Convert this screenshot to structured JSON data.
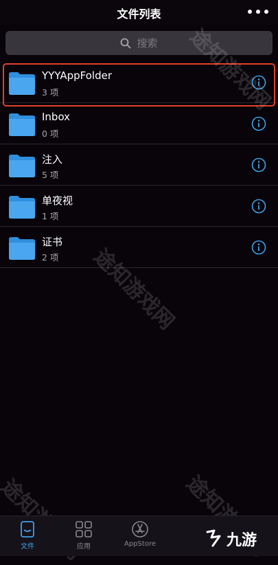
{
  "nav": {
    "title": "文件列表"
  },
  "search": {
    "placeholder": "搜索"
  },
  "folders": [
    {
      "name": "YYYAppFolder",
      "count": "3 项"
    },
    {
      "name": "Inbox",
      "count": "0 项"
    },
    {
      "name": "注入",
      "count": "5 项"
    },
    {
      "name": "单夜视",
      "count": "1 项"
    },
    {
      "name": "证书",
      "count": "2 项"
    }
  ],
  "tabs": [
    {
      "label": "文件",
      "icon": "files-tab-icon",
      "active": true
    },
    {
      "label": "应用",
      "icon": "apps-grid-icon",
      "active": false
    },
    {
      "label": "AppStore",
      "icon": "appstore-icon",
      "active": false
    }
  ],
  "watermark": "途知游戏网",
  "brand": "九游",
  "colors": {
    "accent": "#3ea2e8",
    "folder": "#2f8fdc",
    "highlight": "#e2402a",
    "background": "#08040a"
  }
}
